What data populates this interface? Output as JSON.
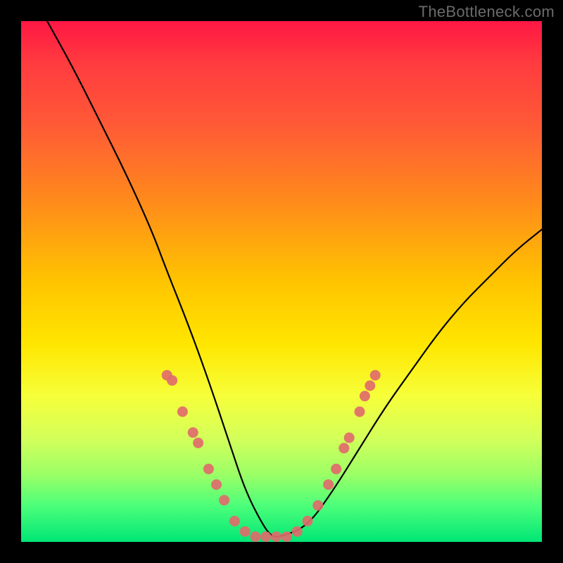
{
  "watermark": "TheBottleneck.com",
  "chart_data": {
    "type": "line",
    "title": "",
    "xlabel": "",
    "ylabel": "",
    "xlim": [
      0,
      100
    ],
    "ylim": [
      0,
      100
    ],
    "grid": false,
    "series": [
      {
        "name": "bottleneck-curve",
        "x": [
          5,
          10,
          15,
          20,
          25,
          28,
          32,
          36,
          40,
          43,
          46,
          48,
          50,
          55,
          60,
          65,
          70,
          75,
          80,
          85,
          90,
          95,
          100
        ],
        "y": [
          100,
          91,
          81,
          71,
          60,
          52,
          42,
          31,
          19,
          10,
          4,
          1,
          1,
          3,
          10,
          18,
          26,
          33,
          40,
          46,
          51,
          56,
          60
        ]
      }
    ],
    "scatter": {
      "name": "dots",
      "color": "#e06b6b",
      "points": [
        {
          "x": 28,
          "y": 32
        },
        {
          "x": 29,
          "y": 31
        },
        {
          "x": 31,
          "y": 25
        },
        {
          "x": 33,
          "y": 21
        },
        {
          "x": 34,
          "y": 19
        },
        {
          "x": 36,
          "y": 14
        },
        {
          "x": 37.5,
          "y": 11
        },
        {
          "x": 39,
          "y": 8
        },
        {
          "x": 41,
          "y": 4
        },
        {
          "x": 43,
          "y": 2
        },
        {
          "x": 45,
          "y": 1
        },
        {
          "x": 47,
          "y": 1
        },
        {
          "x": 49,
          "y": 1
        },
        {
          "x": 51,
          "y": 1
        },
        {
          "x": 53,
          "y": 2
        },
        {
          "x": 55,
          "y": 4
        },
        {
          "x": 57,
          "y": 7
        },
        {
          "x": 59,
          "y": 11
        },
        {
          "x": 60.5,
          "y": 14
        },
        {
          "x": 62,
          "y": 18
        },
        {
          "x": 63,
          "y": 20
        },
        {
          "x": 65,
          "y": 25
        },
        {
          "x": 66,
          "y": 28
        },
        {
          "x": 67,
          "y": 30
        },
        {
          "x": 68,
          "y": 32
        }
      ]
    }
  }
}
